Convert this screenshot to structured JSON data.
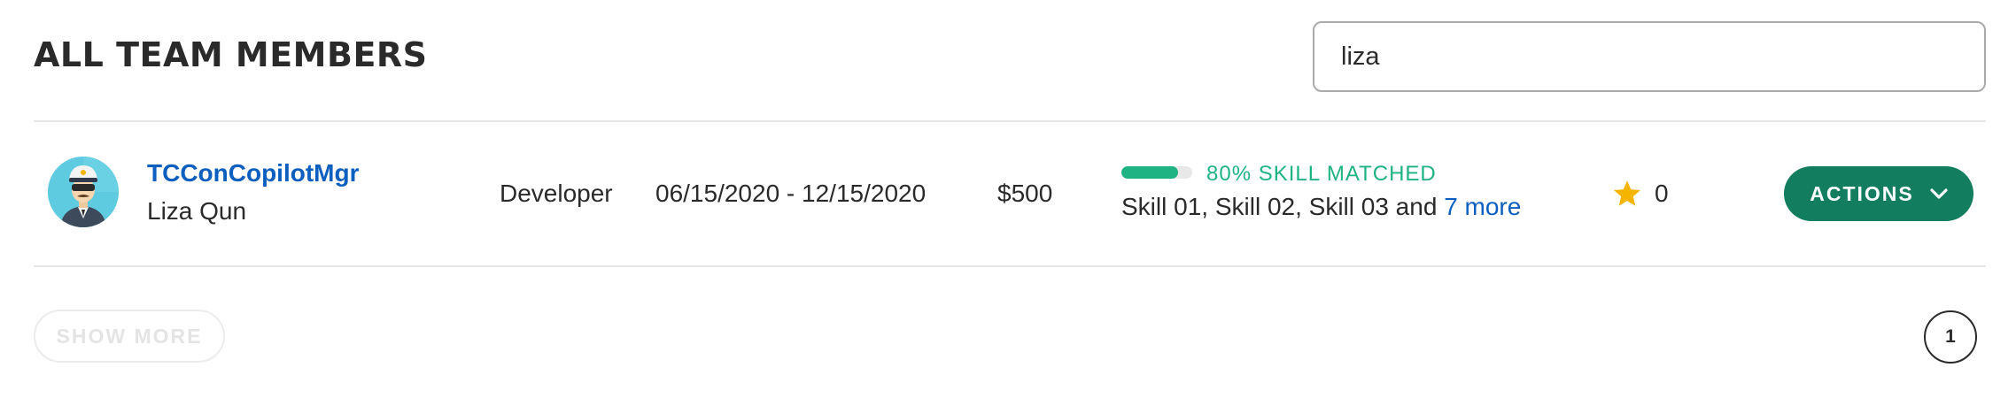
{
  "header": {
    "title": "ALL TEAM MEMBERS",
    "search_value": "liza"
  },
  "member": {
    "handle": "TCConCopilotMgr",
    "name": "Liza Qun",
    "role": "Developer",
    "dates": "06/15/2020 - 12/15/2020",
    "rate": "$500",
    "skill_match_percent": 80,
    "skill_match_label": "80% SKILL MATCHED",
    "skills_text": "Skill 01, Skill 02, Skill 03 and ",
    "more_skills_link": "7 more",
    "rating": "0",
    "actions_label": "ACTIONS"
  },
  "footer": {
    "show_more_label": "SHOW MORE",
    "current_page": "1"
  },
  "colors": {
    "link": "#0c5fbf",
    "accent_green": "#1fb384",
    "actions_button": "#137d60",
    "star": "#f5b400"
  },
  "icons": {
    "avatar": "copilot-avatar-icon",
    "star": "star-icon",
    "chevron": "chevron-down-icon"
  }
}
